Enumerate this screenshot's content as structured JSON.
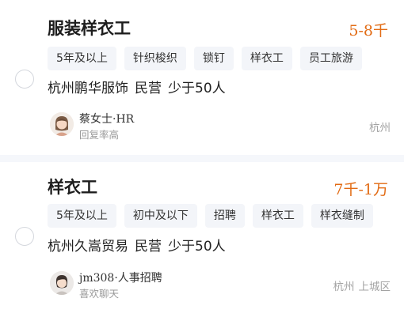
{
  "jobs": [
    {
      "title": "服装样衣工",
      "salary": "5-8千",
      "tags": [
        "5年及以上",
        "针织梭织",
        "锁钉",
        "样衣工",
        "员工旅游"
      ],
      "company": "杭州鹏华服饰",
      "company_type": "民营",
      "company_size": "少于50人",
      "recruiter_name": "蔡女士·HR",
      "recruiter_status": "回复率高",
      "city": "杭州",
      "district": ""
    },
    {
      "title": "样衣工",
      "salary": "7千-1万",
      "tags": [
        "5年及以上",
        "初中及以下",
        "招聘",
        "样衣工",
        "样衣缝制"
      ],
      "company": "杭州久嵩贸易",
      "company_type": "民营",
      "company_size": "少于50人",
      "recruiter_name": "jm308·人事招聘",
      "recruiter_status": "喜欢聊天",
      "city": "杭州",
      "district": "上城区"
    }
  ],
  "colors": {
    "salary": "#e26b14",
    "tag_bg": "#f3f5f9",
    "page_bg": "#f5f7fb"
  },
  "icons": {
    "select": "radio-circle-icon",
    "avatar": "recruiter-avatar-icon"
  }
}
